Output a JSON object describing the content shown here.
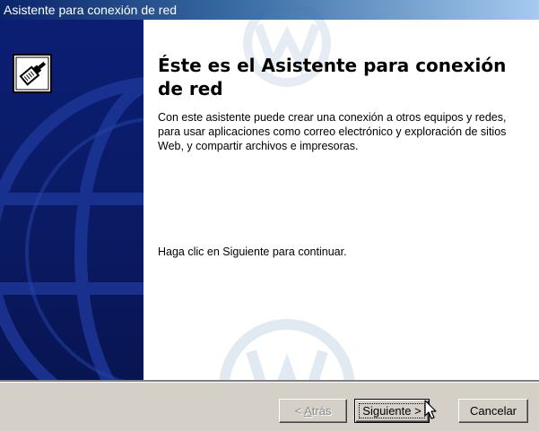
{
  "window": {
    "title": "Asistente para conexión de red"
  },
  "content": {
    "heading": "Éste es el Asistente para conexión de red",
    "description": "Con este asistente puede crear una conexión a otros equipos y redes, para usar aplicaciones como correo electrónico y exploración de sitios Web, y compartir archivos e impresoras.",
    "continue_text": "Haga clic en Siguiente para continuar."
  },
  "buttons": {
    "back_prefix": "< ",
    "back_accel": "A",
    "back_rest": "trás",
    "next_label": "Siguiente >",
    "cancel_label": "Cancelar"
  },
  "icons": {
    "wizard": "network-cable-icon",
    "cursor": "mouse-pointer-icon"
  },
  "colors": {
    "side_panel": "#0b1e73",
    "title_bar": "#0a246a",
    "footer": "#d4d0c8"
  },
  "state": {
    "back_enabled": false,
    "next_focused": true
  }
}
